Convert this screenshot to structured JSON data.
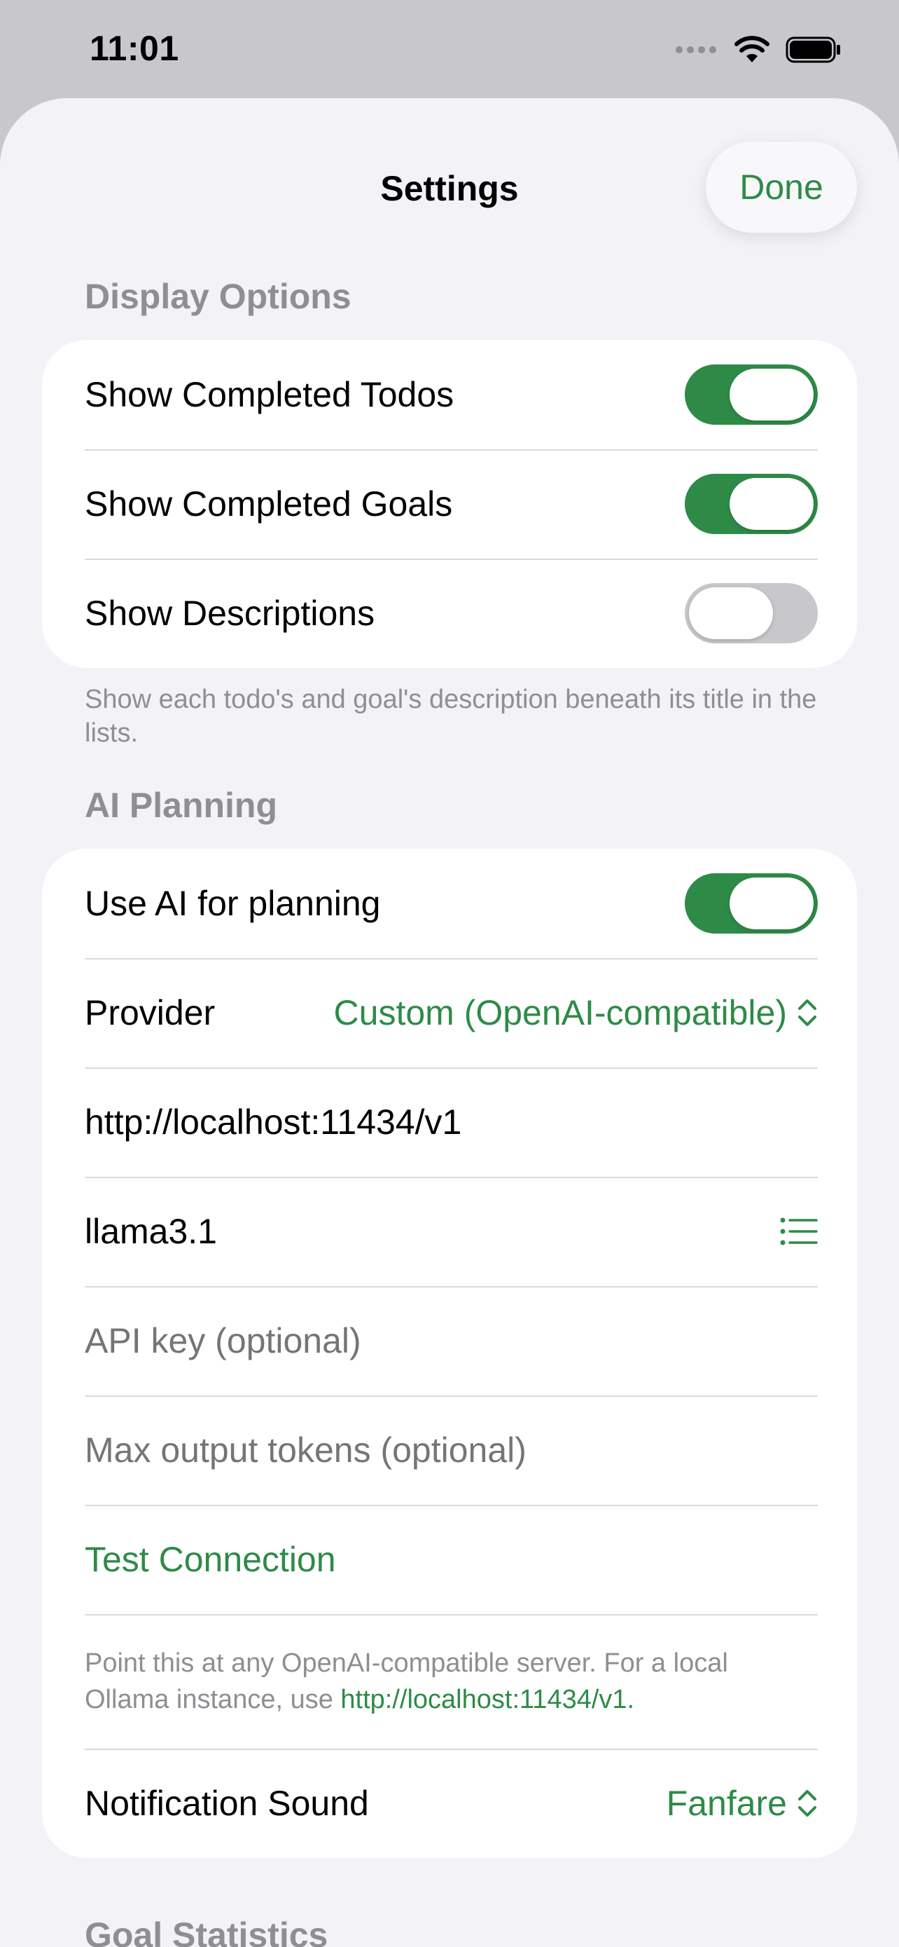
{
  "status_bar": {
    "time": "11:01"
  },
  "nav": {
    "title": "Settings",
    "done_label": "Done"
  },
  "display_options": {
    "header": "Display Options",
    "rows": [
      {
        "label": "Show Completed Todos",
        "on": true
      },
      {
        "label": "Show Completed Goals",
        "on": true
      },
      {
        "label": "Show Descriptions",
        "on": false
      }
    ],
    "footer": "Show each todo's and goal's description beneath its title in the lists."
  },
  "ai_planning": {
    "header": "AI Planning",
    "use_ai_label": "Use AI for planning",
    "use_ai_on": true,
    "provider_label": "Provider",
    "provider_value": "Custom (OpenAI-compatible)",
    "base_url": "http://localhost:11434/v1",
    "model": "llama3.1",
    "api_key_placeholder": "API key (optional)",
    "max_tokens_placeholder": "Max output tokens (optional)",
    "test_connection": "Test Connection",
    "note_text": "Point this at any OpenAI-compatible server. For a local Ollama instance, use ",
    "note_link": "http://localhost:11434/v1",
    "note_end": ".",
    "notification_label": "Notification Sound",
    "notification_value": "Fanfare"
  },
  "goal_statistics": {
    "header": "Goal Statistics"
  },
  "colors": {
    "accent": "#2e8b47",
    "secondary_text": "#8e8e93",
    "background": "#f2f2f7"
  },
  "icons": [
    "cellular-icon",
    "wifi-icon",
    "battery-icon",
    "chevron-up-down-icon",
    "list-icon"
  ]
}
